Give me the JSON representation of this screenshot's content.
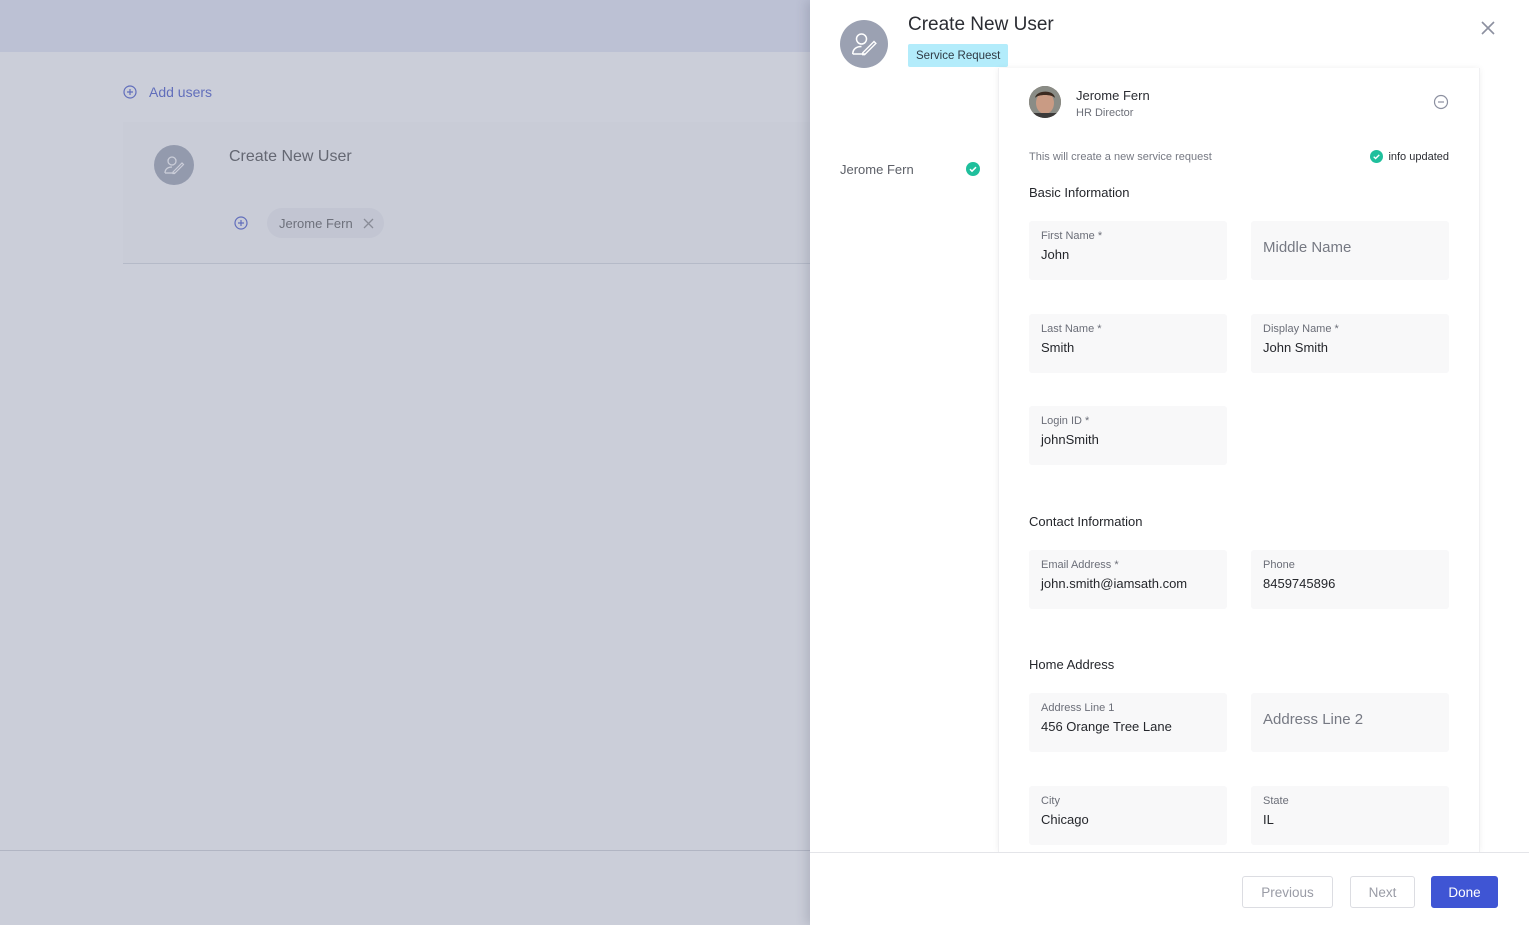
{
  "background": {
    "add_users_label": "Add users",
    "card_title": "Create New User",
    "chip_label": "Jerome Fern"
  },
  "drawer": {
    "title": "Create New User",
    "badge": "Service Request",
    "steps": [
      {
        "label": "Jerome Fern",
        "status": "complete"
      }
    ],
    "user": {
      "name": "Jerome Fern",
      "role": "HR Director"
    },
    "note": "This will create a new service request",
    "status_text": "info updated",
    "sections": {
      "basic": "Basic Information",
      "contact": "Contact Information",
      "home": "Home Address"
    },
    "fields": {
      "first_name": {
        "label": "First Name *",
        "value": "John"
      },
      "middle_name": {
        "placeholder": "Middle Name"
      },
      "last_name": {
        "label": "Last Name *",
        "value": "Smith"
      },
      "display_name": {
        "label": "Display Name *",
        "value": "John Smith"
      },
      "login_id": {
        "label": "Login ID *",
        "value": "johnSmith"
      },
      "email": {
        "label": "Email Address *",
        "value": "john.smith@iamsath.com"
      },
      "phone": {
        "label": "Phone",
        "value": "8459745896"
      },
      "address1": {
        "label": "Address Line 1",
        "value": "456 Orange Tree Lane"
      },
      "address2": {
        "placeholder": "Address Line 2"
      },
      "city": {
        "label": "City",
        "value": "Chicago"
      },
      "state": {
        "label": "State",
        "value": "IL"
      }
    },
    "footer": {
      "previous": "Previous",
      "next": "Next",
      "done": "Done"
    }
  },
  "colors": {
    "primary": "#3f55d4",
    "success": "#1fbf9c",
    "badge_bg": "#b3ecfb"
  }
}
